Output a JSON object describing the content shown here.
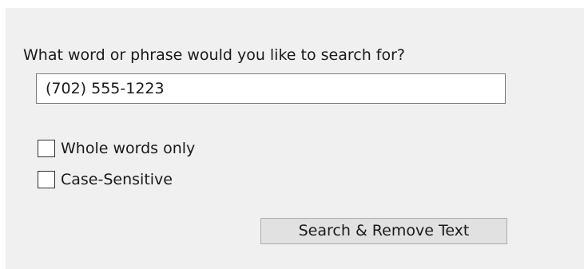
{
  "dialog": {
    "prompt": "What word or phrase would you like to search for?",
    "search_value": "(702) 555-1223",
    "options": [
      {
        "label": "Whole words only",
        "checked": false
      },
      {
        "label": "Case-Sensitive",
        "checked": false
      }
    ],
    "action_label": "Search & Remove Text"
  },
  "colors": {
    "panel_background": "#f0f0f0",
    "button_background": "#e1e1e1",
    "input_border": "#7a7a7a"
  }
}
